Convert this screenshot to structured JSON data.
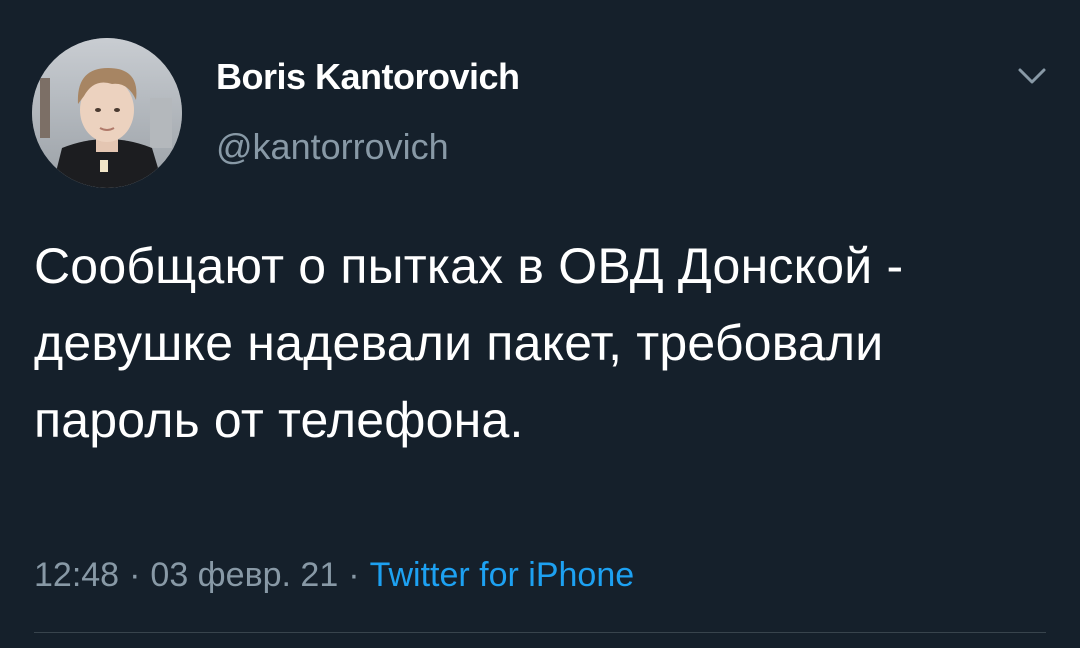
{
  "tweet": {
    "author": {
      "display_name": "Boris Kantorovich",
      "handle": "@kantorrovich"
    },
    "text": "Сообщают о пытках в ОВД Донской - девушке надевали пакет, требовали пароль от телефона.",
    "time": "12:48",
    "date": "03 февр. 21",
    "separator": "·",
    "source": "Twitter for iPhone"
  },
  "icons": {
    "menu": "chevron-down-icon"
  },
  "colors": {
    "background": "#15202b",
    "primary_text": "#ffffff",
    "secondary_text": "#8899a6",
    "link": "#1da1f2",
    "divider": "#38444d"
  }
}
